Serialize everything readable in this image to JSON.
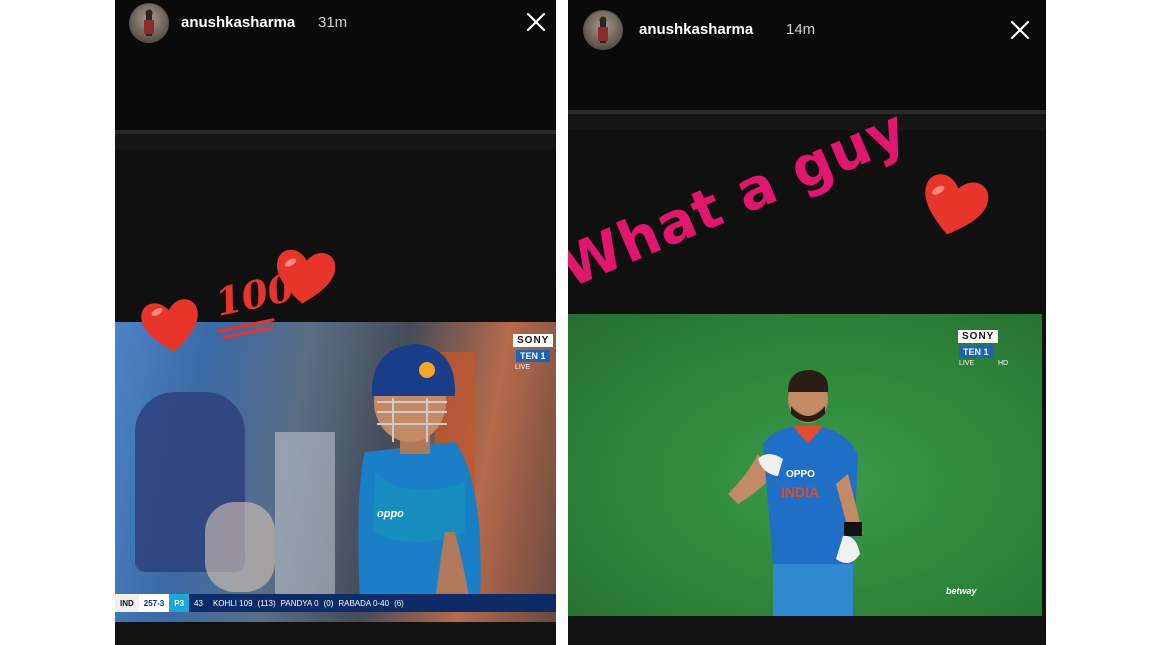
{
  "stories": [
    {
      "username": "anushkasharma",
      "time": "31m",
      "stickers": {
        "hundred": "100"
      },
      "tv": {
        "channel_logo": "SONY",
        "channel_name": "TEN 1",
        "live_tag": "LIVE",
        "jersey_sponsor": "oppo",
        "scorebar": {
          "team": "IND",
          "score": "257-3",
          "powerplay": "P3",
          "powerplay_overs": "43",
          "batsman1": "KOHLI 109",
          "batsman1_balls": "(113)",
          "batsman2": "PANDYA 0",
          "batsman2_balls": "(0)",
          "bowler": "RABADA 0-40",
          "bowler_overs": "(6)"
        }
      }
    },
    {
      "username": "anushkasharma",
      "time": "14m",
      "stickers": {
        "text": "What a guy"
      },
      "tv": {
        "channel_logo": "SONY",
        "channel_name": "TEN 1",
        "live_tag": "LIVE",
        "hd_tag": "HD",
        "jersey_sponsor": "OPPO",
        "jersey_text": "INDIA",
        "broadcaster_mark": "betway"
      }
    }
  ],
  "colors": {
    "sticker_pink": "#e0176c",
    "heart_red": "#e8352b",
    "pitch_green": "#2f8a3c"
  },
  "icons": [
    "close-icon",
    "avatar",
    "heart-icon",
    "hundred-points-icon"
  ]
}
